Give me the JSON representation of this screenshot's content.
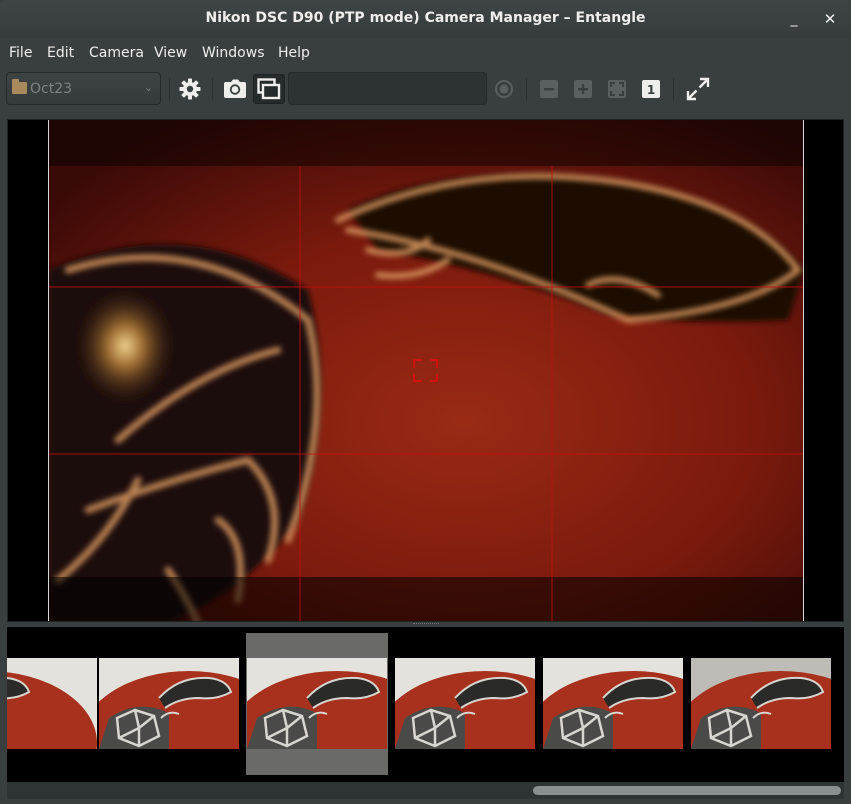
{
  "window": {
    "title": "Nikon DSC D90 (PTP mode) Camera Manager – Entangle",
    "minimize_glyph": "_",
    "close_glyph": "✕"
  },
  "menubar": {
    "items": [
      "File",
      "Edit",
      "Camera",
      "View",
      "Windows",
      "Help"
    ]
  },
  "toolbar": {
    "session_selector": {
      "value": "Oct23",
      "icon": "folder-icon"
    },
    "buttons": [
      {
        "name": "settings",
        "icon": "gear-icon",
        "enabled": true
      },
      {
        "name": "capture",
        "icon": "camera-icon",
        "enabled": true
      },
      {
        "name": "preview",
        "icon": "preview-icon",
        "enabled": true,
        "active": true
      },
      {
        "name": "cancel",
        "icon": "record-icon",
        "enabled": false
      },
      {
        "name": "zoom-out",
        "icon": "zoom-out-icon",
        "enabled": false
      },
      {
        "name": "zoom-in",
        "icon": "zoom-in-icon",
        "enabled": false
      },
      {
        "name": "zoom-fit",
        "icon": "zoom-fit-icon",
        "enabled": false
      },
      {
        "name": "zoom-100",
        "icon": "zoom-100-icon",
        "label": "1",
        "enabled": true
      },
      {
        "name": "fullscreen",
        "icon": "fullscreen-icon",
        "enabled": true
      }
    ],
    "status_text": ""
  },
  "preview": {
    "grid_color": "#c40d0d",
    "focus_frame_color": "#d21010"
  },
  "filmstrip": {
    "thumbnail_count": 6,
    "selected_index": 2
  },
  "colors": {
    "window_bg": "#393f3f",
    "accent_red": "#b52a15"
  }
}
